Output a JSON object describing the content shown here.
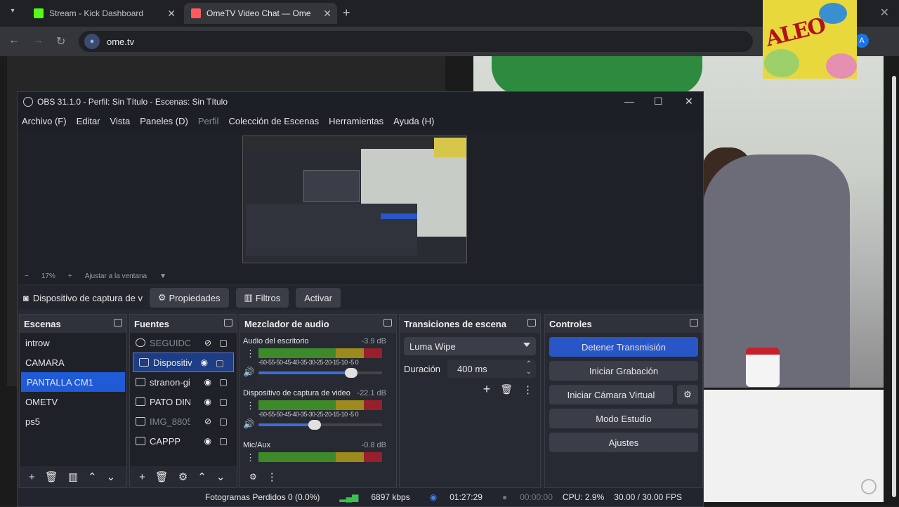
{
  "browser": {
    "tabs": [
      {
        "title": "Stream - Kick Dashboard",
        "favicon_color": "#53fc18"
      },
      {
        "title": "OmeTV Video Chat — Ome",
        "favicon_color": "#ff5a5f"
      }
    ],
    "url": "ome.tv",
    "profile_initial": "A"
  },
  "overlay_logo_text": "ALEO",
  "obs": {
    "title": "OBS 31.1.0 - Perfil: Sin Título - Escenas: Sin Título",
    "menu": [
      "Archivo (F)",
      "Editar",
      "Vista",
      "Paneles (D)",
      "Perfil",
      "Colección de Escenas",
      "Herramientas",
      "Ayuda (H)"
    ],
    "zoom": {
      "minus": "−",
      "level": "17%",
      "plus": "+",
      "fit": "Ajustar a la ventana"
    },
    "source_bar": {
      "selected": "Dispositivo de captura de v",
      "properties": "Propiedades",
      "filters": "Filtros",
      "activate": "Activar"
    },
    "scenes": {
      "title": "Escenas",
      "items": [
        "introw",
        "CAMARA",
        "PANTALLA CM1",
        "OMETV",
        "ps5"
      ],
      "selected_index": 2
    },
    "sources": {
      "title": "Fuentes",
      "items": [
        {
          "name": "SEGUIDOF",
          "visible": false
        },
        {
          "name": "Dispositiv",
          "visible": true
        },
        {
          "name": "stranon-gi",
          "visible": true
        },
        {
          "name": "PATO DINI",
          "visible": true
        },
        {
          "name": "IMG_8805",
          "visible": false
        },
        {
          "name": "CAPPP",
          "visible": true
        }
      ]
    },
    "mixer": {
      "title": "Mezclador de audio",
      "ticks": "-60-55-50-45-40-35-30-25-20-15-10 -5 0",
      "channels": [
        {
          "name": "Audio del escritorio",
          "db": "-3.9 dB",
          "level": 0.78
        },
        {
          "name": "Dispositivo de captura de video",
          "db": "-22.1 dB",
          "level": 0.45
        },
        {
          "name": "Mic/Aux",
          "db": "-0.8 dB",
          "level": 0.98
        }
      ]
    },
    "transitions": {
      "title": "Transiciones de escena",
      "selected": "Luma Wipe",
      "duration_label": "Duración",
      "duration_value": "400 ms"
    },
    "controls": {
      "title": "Controles",
      "stop_stream": "Detener Transmisión",
      "start_recording": "Iniciar Grabación",
      "start_virtual_cam": "Iniciar Cámara Virtual",
      "studio_mode": "Modo Estudio",
      "settings": "Ajustes"
    },
    "status": {
      "dropped_frames": "Fotogramas Perdidos 0 (0.0%)",
      "bitrate": "6897 kbps",
      "stream_time": "01:27:29",
      "record_time": "00:00:00",
      "cpu": "CPU: 2.9%",
      "fps": "30.00 / 30.00 FPS"
    }
  }
}
